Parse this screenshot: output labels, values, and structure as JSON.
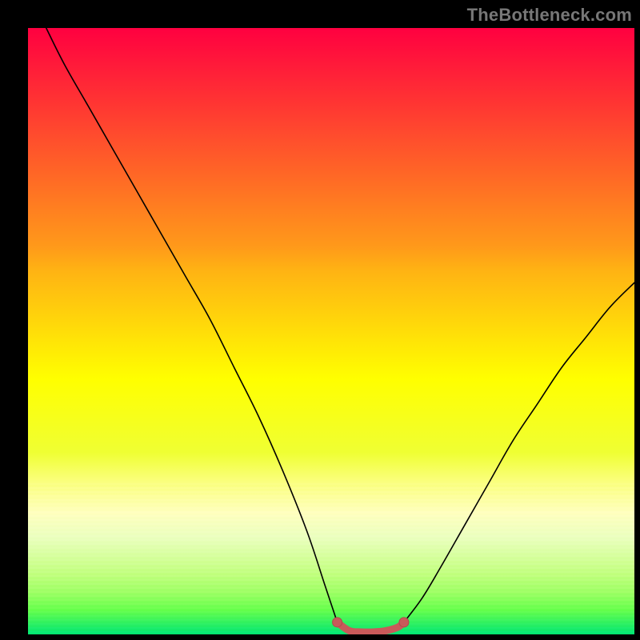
{
  "watermark": "TheBottleneck.com",
  "colors": {
    "frame": "#000000",
    "curve": "#000000",
    "marker_fill": "#c95a5a",
    "marker_stroke": "#b24a4a"
  },
  "chart_data": {
    "type": "line",
    "title": "",
    "xlabel": "",
    "ylabel": "",
    "xlim": [
      0,
      100
    ],
    "ylim": [
      0,
      100
    ],
    "grid": false,
    "legend": false,
    "series": [
      {
        "name": "left-branch",
        "x": [
          3,
          6,
          10,
          14,
          18,
          22,
          26,
          30,
          34,
          38,
          42,
          46,
          49,
          51
        ],
        "values": [
          100,
          94,
          87,
          80,
          73,
          66,
          59,
          52,
          44,
          36,
          27,
          17,
          8,
          2
        ]
      },
      {
        "name": "right-branch",
        "x": [
          62,
          65,
          68,
          72,
          76,
          80,
          84,
          88,
          92,
          96,
          100
        ],
        "values": [
          2,
          6,
          11,
          18,
          25,
          32,
          38,
          44,
          49,
          54,
          58
        ]
      },
      {
        "name": "valley-marker",
        "x": [
          51,
          53,
          55,
          57,
          59,
          61,
          62
        ],
        "values": [
          2,
          0.6,
          0.4,
          0.4,
          0.6,
          1.2,
          2
        ]
      }
    ]
  }
}
